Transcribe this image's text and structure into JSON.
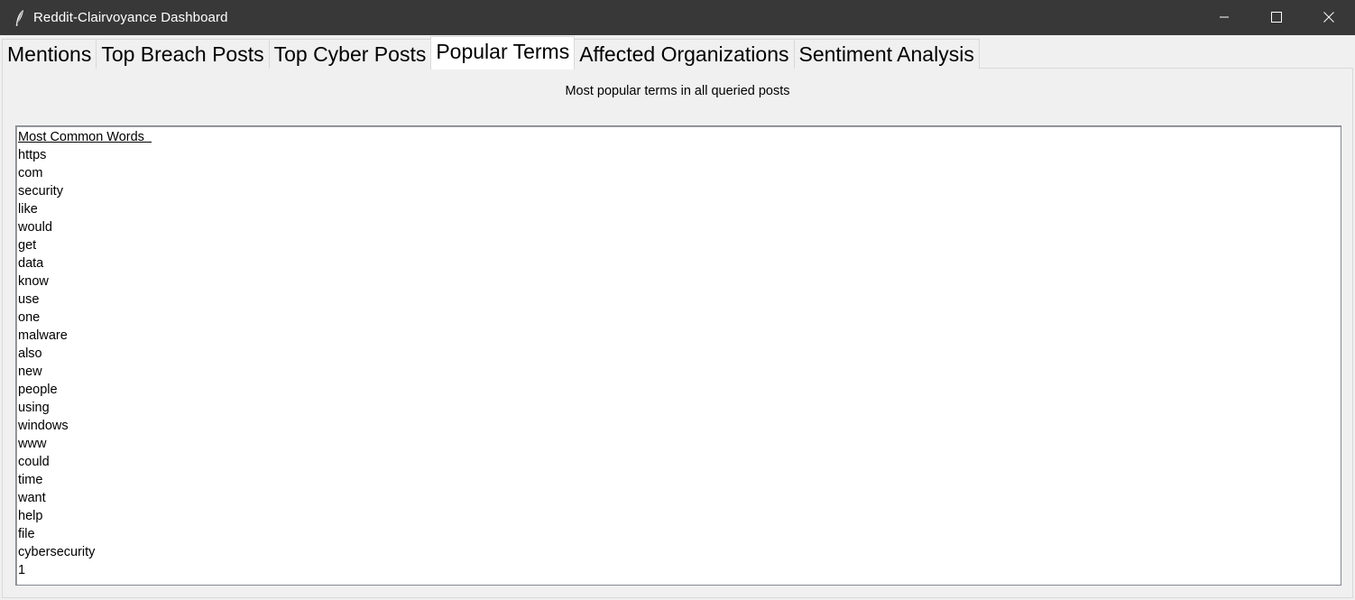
{
  "window": {
    "title": "Reddit-Clairvoyance Dashboard",
    "app_icon": "feather-icon",
    "controls": [
      "minimize-icon",
      "maximize-icon",
      "close-icon"
    ],
    "titlebar_color": "#383838"
  },
  "tabs": [
    {
      "label": "Mentions",
      "active": false
    },
    {
      "label": "Top Breach Posts",
      "active": false
    },
    {
      "label": "Top Cyber Posts",
      "active": false
    },
    {
      "label": "Popular Terms",
      "active": true
    },
    {
      "label": "Affected Organizations",
      "active": false
    },
    {
      "label": "Sentiment Analysis",
      "active": false
    }
  ],
  "panel": {
    "subtitle": "Most popular terms in all queried posts",
    "list_header": "Most Common Words  ",
    "words": [
      "https",
      "com",
      "security",
      "like",
      "would",
      "get",
      "data",
      "know",
      "use",
      "one",
      "malware",
      "also",
      "new",
      "people",
      "using",
      "windows",
      "www",
      "could",
      "time",
      "want",
      "help",
      "file",
      "cybersecurity",
      "1"
    ]
  }
}
